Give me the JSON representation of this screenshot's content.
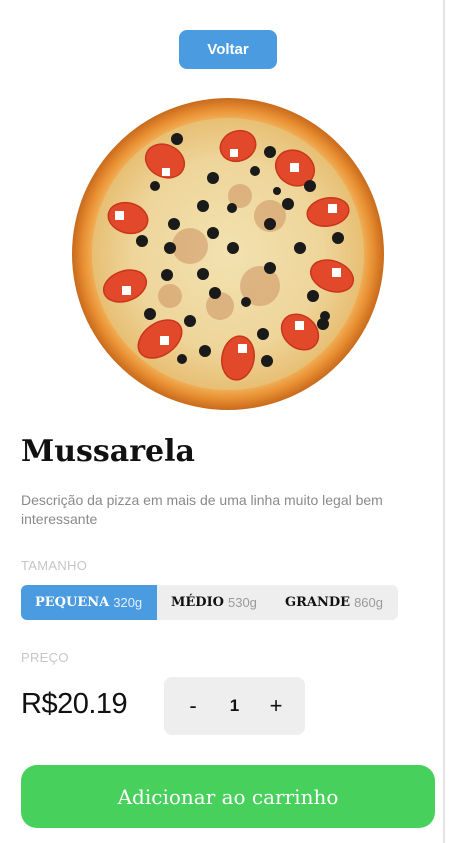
{
  "header": {
    "back_label": "Voltar"
  },
  "product": {
    "name": "Mussarela",
    "description": "Descrição da pizza em mais de uma linha muito legal bem interessante"
  },
  "size_section": {
    "label": "TAMANHO",
    "options": [
      {
        "name": "PEQUENA",
        "weight": "320g",
        "selected": true
      },
      {
        "name": "MÉDIO",
        "weight": "530g",
        "selected": false
      },
      {
        "name": "GRANDE",
        "weight": "860g",
        "selected": false
      }
    ]
  },
  "price_section": {
    "label": "PREÇO",
    "value": "R$20.19"
  },
  "quantity": {
    "minus": "-",
    "value": "1",
    "plus": "+"
  },
  "cart": {
    "add_label": "Adicionar ao carrinho"
  },
  "colors": {
    "accent": "#4a9be0",
    "add_button": "#47d05b"
  }
}
